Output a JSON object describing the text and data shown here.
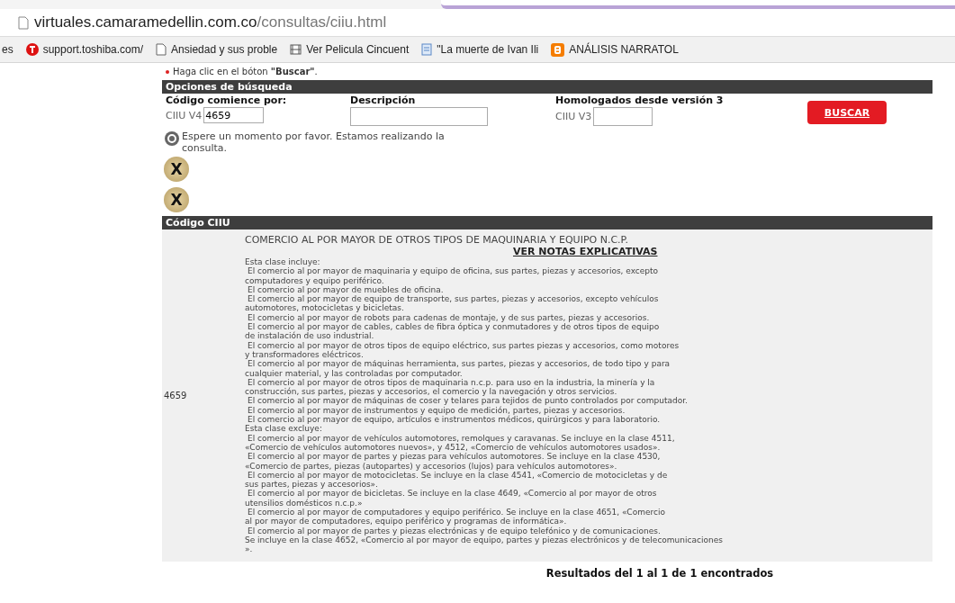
{
  "browser": {
    "url_host": "virtuales.camaramedellin.com.co",
    "url_path": "/consultas/ciiu.html",
    "bookmarks": [
      {
        "kind": "cut",
        "label": "es"
      },
      {
        "kind": "toshiba",
        "label": "support.toshiba.com/"
      },
      {
        "kind": "page",
        "label": "Ansiedad y sus proble"
      },
      {
        "kind": "film",
        "label": "Ver Pelicula Cincuent"
      },
      {
        "kind": "doc",
        "label": "\"La muerte de Ivan Ili"
      },
      {
        "kind": "blogger",
        "label": "ANÁLISIS NARRATOL"
      }
    ]
  },
  "instruction": "Haga clic en el bóton **\"Buscar\"**.",
  "search": {
    "title": "Opciones de búsqueda",
    "code_label": "Código comience por:",
    "code_prefix": "CIIU V4",
    "code_value": "4659",
    "description_label": "Descripción",
    "homolog_label": "Homologados desde versión 3",
    "homolog_prefix": "CIIU V3",
    "button": "BUSCAR",
    "loading": "Espere un momento por favor. Estamos realizando la consulta.",
    "close_buttons": [
      "X",
      "X"
    ]
  },
  "results": {
    "header": "Código CIIU",
    "rows": [
      {
        "code": "4659",
        "title": "COMERCIO AL POR MAYOR DE OTROS TIPOS DE MAQUINARIA Y EQUIPO N.C.P.",
        "link": "VER NOTAS EXPLICATIVAS",
        "lines": [
          {
            "kind": "heading",
            "text": "Esta clase incluye:"
          },
          {
            "kind": "item",
            "text": "El comercio al por mayor de maquinaria y equipo de oficina, sus partes, piezas y accesorios, excepto"
          },
          {
            "kind": "cont",
            "text": "computadores y equipo periférico."
          },
          {
            "kind": "item",
            "text": "El comercio al por mayor de muebles de oficina."
          },
          {
            "kind": "item",
            "text": "El comercio al por mayor de equipo de transporte, sus partes, piezas y accesorios, excepto vehículos"
          },
          {
            "kind": "cont",
            "text": "automotores, motocicletas y bicicletas."
          },
          {
            "kind": "item",
            "text": "El comercio al por mayor de robots para cadenas de montaje, y de sus partes, piezas y accesorios."
          },
          {
            "kind": "item",
            "text": "El comercio al por mayor de cables, cables de fibra óptica y conmutadores y de otros tipos de equipo"
          },
          {
            "kind": "cont",
            "text": "de instalación de uso industrial."
          },
          {
            "kind": "item",
            "text": "El comercio al por mayor de otros tipos de equipo eléctrico, sus partes piezas y accesorios, como motores"
          },
          {
            "kind": "cont",
            "text": "y transformadores eléctricos."
          },
          {
            "kind": "item",
            "text": "El comercio al por mayor de máquinas herramienta, sus partes, piezas y accesorios, de todo tipo y para"
          },
          {
            "kind": "cont",
            "text": "cualquier material, y las controladas por computador."
          },
          {
            "kind": "item",
            "text": "El comercio al por mayor de otros tipos de maquinaria n.c.p. para uso en la industria, la minería y la"
          },
          {
            "kind": "cont",
            "text": "construcción, sus partes, piezas y accesorios, el comercio y la navegación y otros servicios."
          },
          {
            "kind": "item",
            "text": "El comercio al por mayor de máquinas de coser y telares para tejidos de punto controlados por computador."
          },
          {
            "kind": "item",
            "text": "El comercio al por mayor de instrumentos y equipo de medición, partes, piezas y accesorios."
          },
          {
            "kind": "item",
            "text": "El comercio al por mayor de equipo, artículos e instrumentos médicos, quirúrgicos y para laboratorio."
          },
          {
            "kind": "heading",
            "text": "Esta clase excluye:"
          },
          {
            "kind": "item",
            "text": "El comercio al por mayor de vehículos automotores, remolques y caravanas. Se incluye en la clase 4511,"
          },
          {
            "kind": "cont",
            "text": "«Comercio de vehículos automotores nuevos», y 4512, «Comercio de vehículos automotores usados»."
          },
          {
            "kind": "item",
            "text": "El comercio al por mayor de partes y piezas para vehículos automotores. Se incluye en la clase 4530,"
          },
          {
            "kind": "cont",
            "text": "«Comercio de partes, piezas (autopartes) y accesorios (lujos) para vehículos automotores»."
          },
          {
            "kind": "item",
            "text": "El comercio al por mayor de motocicletas. Se incluye en la clase 4541, «Comercio de motocicletas y de"
          },
          {
            "kind": "cont",
            "text": "sus partes, piezas y accesorios»."
          },
          {
            "kind": "item",
            "text": "El comercio al por mayor de bicicletas. Se incluye en la clase 4649, «Comercio al por mayor de otros"
          },
          {
            "kind": "cont",
            "text": "utensilios domésticos n.c.p.»"
          },
          {
            "kind": "item",
            "text": "El comercio al por mayor de computadores y equipo periférico. Se incluye en la clase 4651, «Comercio"
          },
          {
            "kind": "cont",
            "text": "al por mayor de computadores, equipo periférico y programas de informática»."
          },
          {
            "kind": "item",
            "text": "El comercio al por mayor de partes y piezas electrónicas y de equipo telefónico y de comunicaciones."
          },
          {
            "kind": "cont",
            "text": "Se incluye en la clase 4652, «Comercio al por mayor de equipo, partes y piezas electrónicos y de telecomunicaciones"
          },
          {
            "kind": "cont",
            "text": "»."
          }
        ]
      }
    ],
    "summary": "Resultados del 1 al 1 de 1 encontrados"
  }
}
